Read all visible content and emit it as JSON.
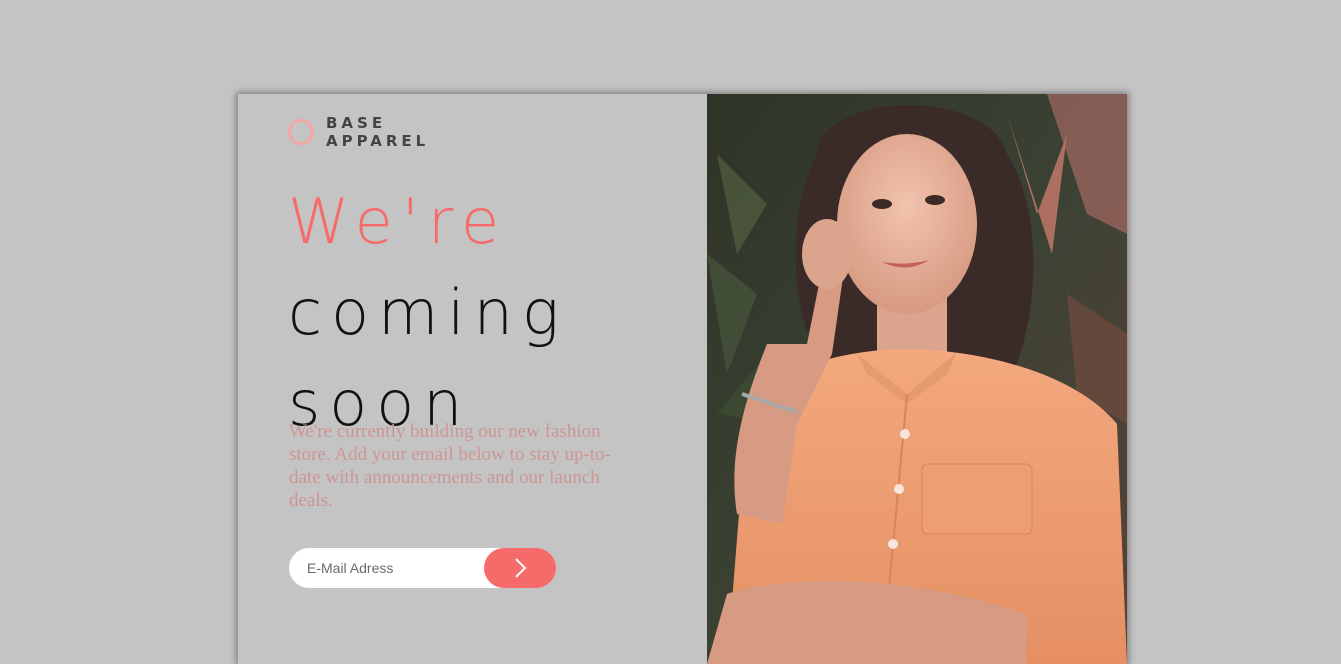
{
  "brand": {
    "line1": "BASE",
    "line2": "APPAREL"
  },
  "hero": {
    "line1": "We're",
    "line2": "coming",
    "line3": "soon",
    "description": "We're currently building our new fashion store. Add your email below to stay up-to-date with announcements and our launch deals."
  },
  "form": {
    "email_placeholder": "E-Mail Adress",
    "email_value": "",
    "submit_icon": "chevron-right-icon"
  },
  "colors": {
    "background": "#c4c4c4",
    "accent": "#f76a6a",
    "description": "#ce9595",
    "headline": "#111111"
  }
}
